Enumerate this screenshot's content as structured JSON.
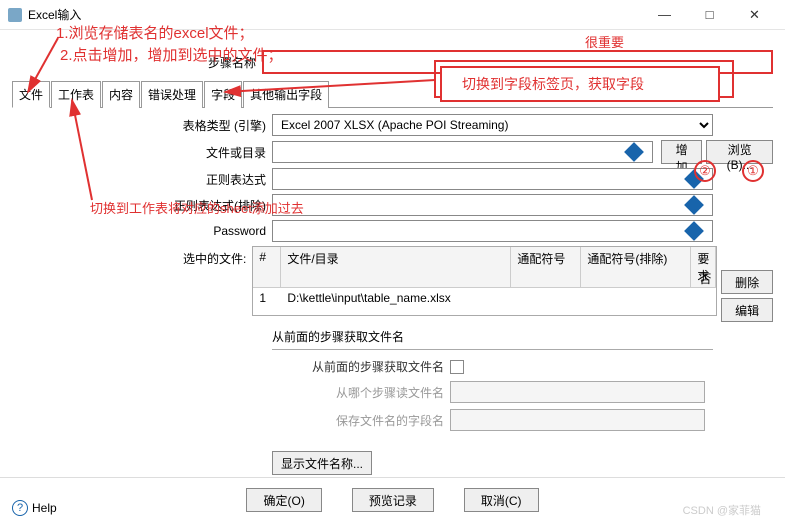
{
  "window": {
    "title": "Excel输入",
    "min": "—",
    "max": "□",
    "close": "✕"
  },
  "annotations": {
    "step1": "1.浏览存储表名的excel文件；",
    "step2": "2.点击增加，增加到选中的文件；",
    "important": "很重要",
    "callout": "切换到字段标签页，获取字段",
    "sheet_tip": "切换到工作表将对应的sheet添加过去",
    "circle1": "①",
    "circle2": "②"
  },
  "step": {
    "label": "步骤名称",
    "value": ""
  },
  "tabs": [
    "文件",
    "工作表",
    "内容",
    "错误处理",
    "字段",
    "其他输出字段"
  ],
  "form": {
    "engine_label": "表格类型 (引擎)",
    "engine_value": "Excel 2007 XLSX (Apache POI Streaming)",
    "file_label": "文件或目录",
    "regex_label": "正则表达式",
    "regex_excl_label": "正则表达式(排除)",
    "password_label": "Password",
    "selected_label": "选中的文件:",
    "add_btn": "增加",
    "browse_btn": "浏览(B)...",
    "delete_btn": "删除",
    "edit_btn": "编辑"
  },
  "table": {
    "headers": [
      "#",
      "文件/目录",
      "通配符号",
      "通配符号(排除)",
      "要求"
    ],
    "row": {
      "num": "1",
      "path": "D:\\kettle\\input\\table_name.xlsx"
    },
    "overflow": "否"
  },
  "fieldset": {
    "title": "从前面的步骤获取文件名",
    "from_prev": "从前面的步骤获取文件名",
    "from_step": "从哪个步骤读文件名",
    "save_field": "保存文件名的字段名"
  },
  "show_names": "显示文件名称...",
  "buttons": {
    "ok": "确定(O)",
    "preview": "预览记录",
    "cancel": "取消(C)"
  },
  "help": "Help",
  "watermark": "CSDN @家菲猫"
}
